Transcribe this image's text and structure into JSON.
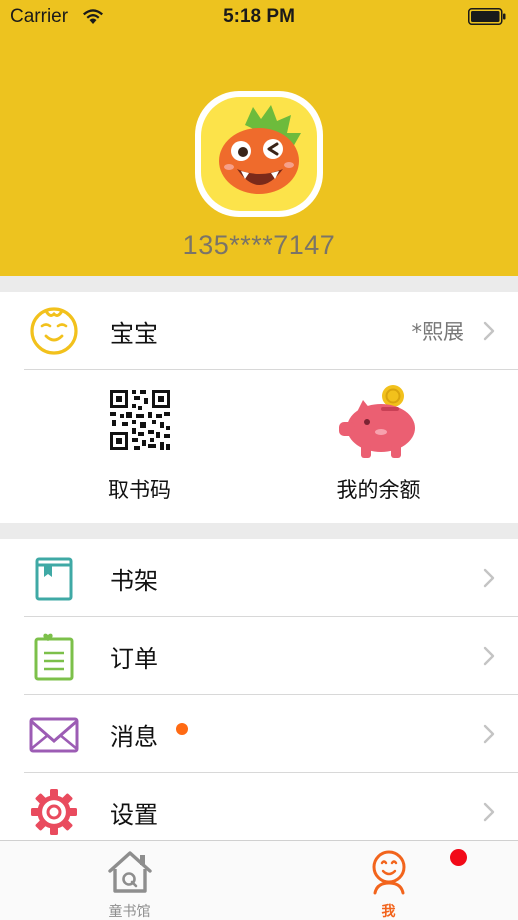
{
  "status_bar": {
    "carrier": "Carrier",
    "time": "5:18 PM"
  },
  "profile": {
    "phone": "135****7147"
  },
  "baby_row": {
    "label": "宝宝",
    "value": "*熙展"
  },
  "quick_actions": [
    {
      "label": "取书码"
    },
    {
      "label": "我的余额"
    }
  ],
  "menu": [
    {
      "label": "书架"
    },
    {
      "label": "订单"
    },
    {
      "label": "消息"
    },
    {
      "label": "设置"
    }
  ],
  "tabbar": {
    "tabs": [
      {
        "label": "童书馆",
        "active": false
      },
      {
        "label": "我",
        "active": true
      }
    ]
  },
  "colors": {
    "header": "#EDC31F",
    "accent": "#F2641C",
    "badge": "#F20A18",
    "message_dot": "#FF6A13"
  }
}
